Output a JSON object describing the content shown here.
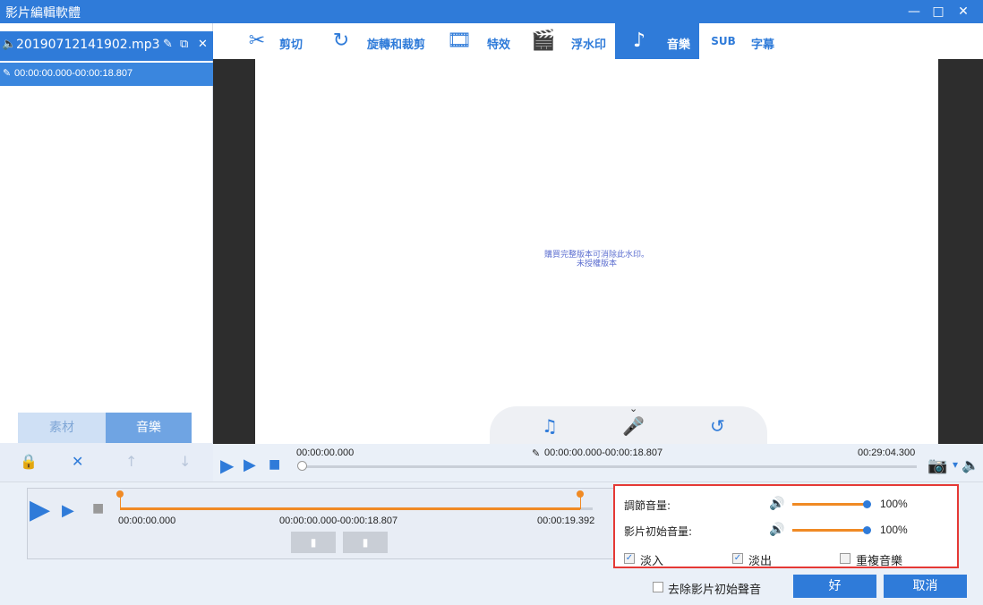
{
  "window": {
    "title": "影片編輯軟體"
  },
  "file": {
    "name": "20190712141902.mp3",
    "clip_range": "00:00:00.000-00:00:18.807"
  },
  "left_tabs": {
    "material": "素材",
    "music": "音樂"
  },
  "toolbar": {
    "items": [
      {
        "label": "剪切",
        "icon": "scissors-icon"
      },
      {
        "label": "旋轉和裁剪",
        "icon": "rotate-crop-icon"
      },
      {
        "label": "特效",
        "icon": "effects-icon"
      },
      {
        "label": "浮水印",
        "icon": "watermark-icon"
      },
      {
        "label": "音樂",
        "icon": "music-note-icon"
      },
      {
        "label": "字幕",
        "icon": "subtitle-icon"
      }
    ],
    "active_index": 4
  },
  "preview": {
    "watermark_line1": "購買完整版本可消除此水印。",
    "watermark_line2": "未授權版本"
  },
  "player": {
    "start": "00:00:00.000",
    "range": "00:00:00.000-00:00:18.807",
    "end": "00:29:04.300"
  },
  "trim": {
    "start": "00:00:00.000",
    "range": "00:00:00.000-00:00:18.807",
    "end": "00:00:19.392"
  },
  "volume": {
    "adjust_label": "調節音量:",
    "adjust_value": "100%",
    "original_label": "影片初始音量:",
    "original_value": "100%",
    "fade_in": "淡入",
    "fade_out": "淡出",
    "repeat": "重複音樂"
  },
  "footer": {
    "remove_original": "去除影片初始聲音",
    "ok": "好",
    "cancel": "取消"
  },
  "colors": {
    "primary": "#2f7bd9",
    "accent": "#f08a24",
    "highlight": "#e53935"
  }
}
